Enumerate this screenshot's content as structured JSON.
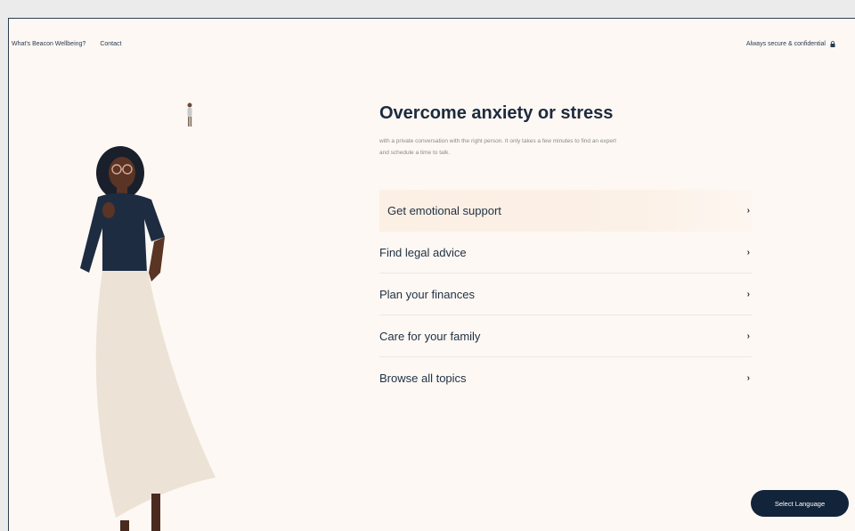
{
  "nav": {
    "whats_beacon": "What's Beacon Wellbeing?",
    "contact": "Contact",
    "secure": "Always secure & confidential"
  },
  "hero": {
    "title": "Overcome anxiety or stress",
    "subtitle_line1": "with a private conversation with the right person. It only takes a few minutes to find an expert",
    "subtitle_line2": "and schedule a time to talk."
  },
  "options": [
    {
      "label": "Get emotional support",
      "chevron": "›",
      "active": true
    },
    {
      "label": "Find legal advice",
      "chevron": "›"
    },
    {
      "label": "Plan your finances",
      "chevron": "›"
    },
    {
      "label": "Care for your family",
      "chevron": "›"
    },
    {
      "label": "Browse all topics",
      "chevron": "›"
    }
  ],
  "language_button": "Select Language",
  "colors": {
    "background": "#fdf8f4",
    "navy": "#12243a",
    "highlight": "#fcefe4"
  },
  "icons": {
    "lock": "lock-icon",
    "chevron": "chevron-right-icon"
  }
}
